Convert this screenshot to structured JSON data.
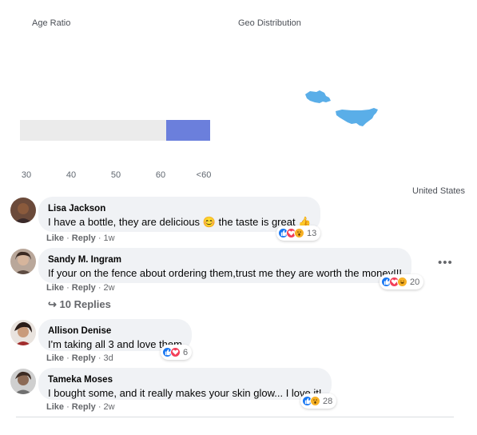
{
  "age": {
    "title": "Age Ratio",
    "ticks": [
      "30",
      "40",
      "50",
      "60",
      "<60"
    ],
    "bar_fill_start_fraction": 0.77,
    "bar_fill_end_fraction": 1.0,
    "bar_color": "#6b7fdc"
  },
  "geo": {
    "title": "Geo Distribution",
    "country_label": "United States",
    "map_color": "#5aaee8"
  },
  "comments": [
    {
      "author": "Lisa Jackson",
      "text": "I have a bottle, they are delicious 😊 the taste is great 👍",
      "like": "Like",
      "reply": "Reply",
      "time": "1w",
      "reaction_count": "13",
      "reactions": [
        "like",
        "love",
        "wow"
      ]
    },
    {
      "author": "Sandy M. Ingram",
      "text": "If your on the fence about ordering them,trust me they are worth the money!!!",
      "like": "Like",
      "reply": "Reply",
      "time": "2w",
      "reaction_count": "20",
      "reactions": [
        "like",
        "love",
        "haha"
      ],
      "replies_label": "10 Replies"
    },
    {
      "author": "Allison Denise",
      "text": "I'm taking all 3 and love them",
      "like": "Like",
      "reply": "Reply",
      "time": "3d",
      "reaction_count": "6",
      "reactions": [
        "like",
        "love"
      ]
    },
    {
      "author": "Tameka Moses",
      "text": "I bought some, and it really makes your skin glow... I love it!",
      "like": "Like",
      "reply": "Reply",
      "time": "2w",
      "reaction_count": "28",
      "reactions": [
        "like",
        "wow"
      ]
    }
  ],
  "colors": {
    "like": "#1877f2",
    "love": "#f33e58",
    "wow": "#f7b125",
    "haha": "#f7b125"
  }
}
